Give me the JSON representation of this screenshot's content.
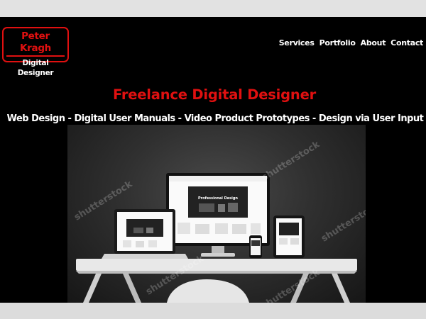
{
  "logo": {
    "name": "Peter Kragh",
    "role": "Digital Designer"
  },
  "nav": {
    "items": [
      "Services",
      "Portfolio",
      "About",
      "Contact"
    ]
  },
  "hero": {
    "headline": "Freelance Digital Designer",
    "subline": "Web Design - Digital User Manuals - Video Product Prototypes - Design via User Input",
    "screen_heading": "Professional Design",
    "watermark": "shutterstock"
  },
  "colors": {
    "accent": "#e01010",
    "background": "#000000",
    "text": "#ffffff"
  }
}
